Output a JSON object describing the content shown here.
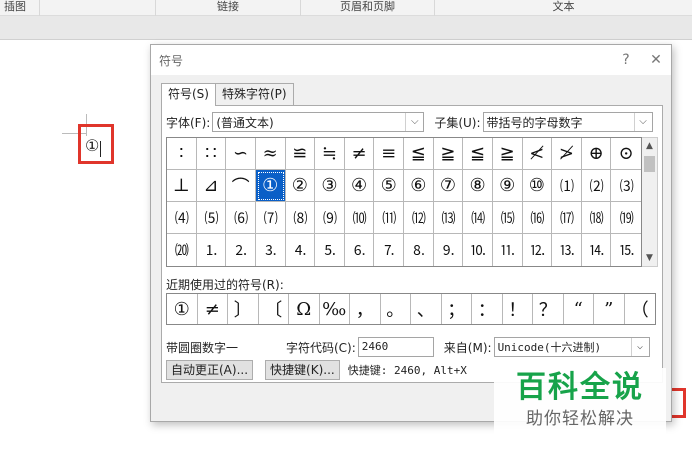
{
  "ribbon": {
    "groups": [
      "插图",
      "链接",
      "页眉和页脚",
      "文本"
    ]
  },
  "document": {
    "inserted_symbol": "①",
    "highlight_color": "#e0352b"
  },
  "dialog": {
    "title": "符号",
    "help_label": "?",
    "close_label": "✕",
    "tabs": [
      "符号(S)",
      "特殊字符(P)"
    ],
    "font_label": "字体(F):",
    "font_value": "(普通文本)",
    "subset_label": "子集(U):",
    "subset_value": "带括号的字母数字",
    "grid_rows": [
      [
        "∶",
        "∷",
        "∽",
        "≈",
        "≌",
        "≒",
        "≠",
        "≡",
        "≦",
        "≧",
        "≦",
        "≧",
        "≮",
        "≯",
        "⊕",
        "⊙"
      ],
      [
        "⊥",
        "⊿",
        "⌒",
        "①",
        "②",
        "③",
        "④",
        "⑤",
        "⑥",
        "⑦",
        "⑧",
        "⑨",
        "⑩",
        "⑴",
        "⑵",
        "⑶"
      ],
      [
        "⑷",
        "⑸",
        "⑹",
        "⑺",
        "⑻",
        "⑼",
        "⑽",
        "⑾",
        "⑿",
        "⒀",
        "⒁",
        "⒂",
        "⒃",
        "⒄",
        "⒅",
        "⒆"
      ],
      [
        "⒇",
        "⒈",
        "⒉",
        "⒊",
        "⒋",
        "⒌",
        "⒍",
        "⒎",
        "⒏",
        "⒐",
        "⒑",
        "⒒",
        "⒓",
        "⒔",
        "⒕",
        "⒖"
      ]
    ],
    "selected_symbol": "①",
    "recent_label": "近期使用过的符号(R):",
    "recent_symbols": [
      "①",
      "≠",
      "〕",
      "〔",
      "Ω",
      "‰",
      "，",
      "。",
      "、",
      "；",
      "：",
      "！",
      "？",
      "“",
      "”",
      "（"
    ],
    "char_name": "带圆圈数字一",
    "char_code_label": "字符代码(C):",
    "char_code_value": "2460",
    "from_label": "来自(M):",
    "from_value": "Unicode(十六进制)",
    "autocorrect_button": "自动更正(A)...",
    "shortcut_button": "快捷键(K)...",
    "shortcut_info": "快捷键: 2460, Alt+X",
    "selection_color": "#0a5fc7"
  },
  "watermark": {
    "main": "百科全说",
    "sub": "助你轻松解决",
    "color": "#17a34a"
  }
}
